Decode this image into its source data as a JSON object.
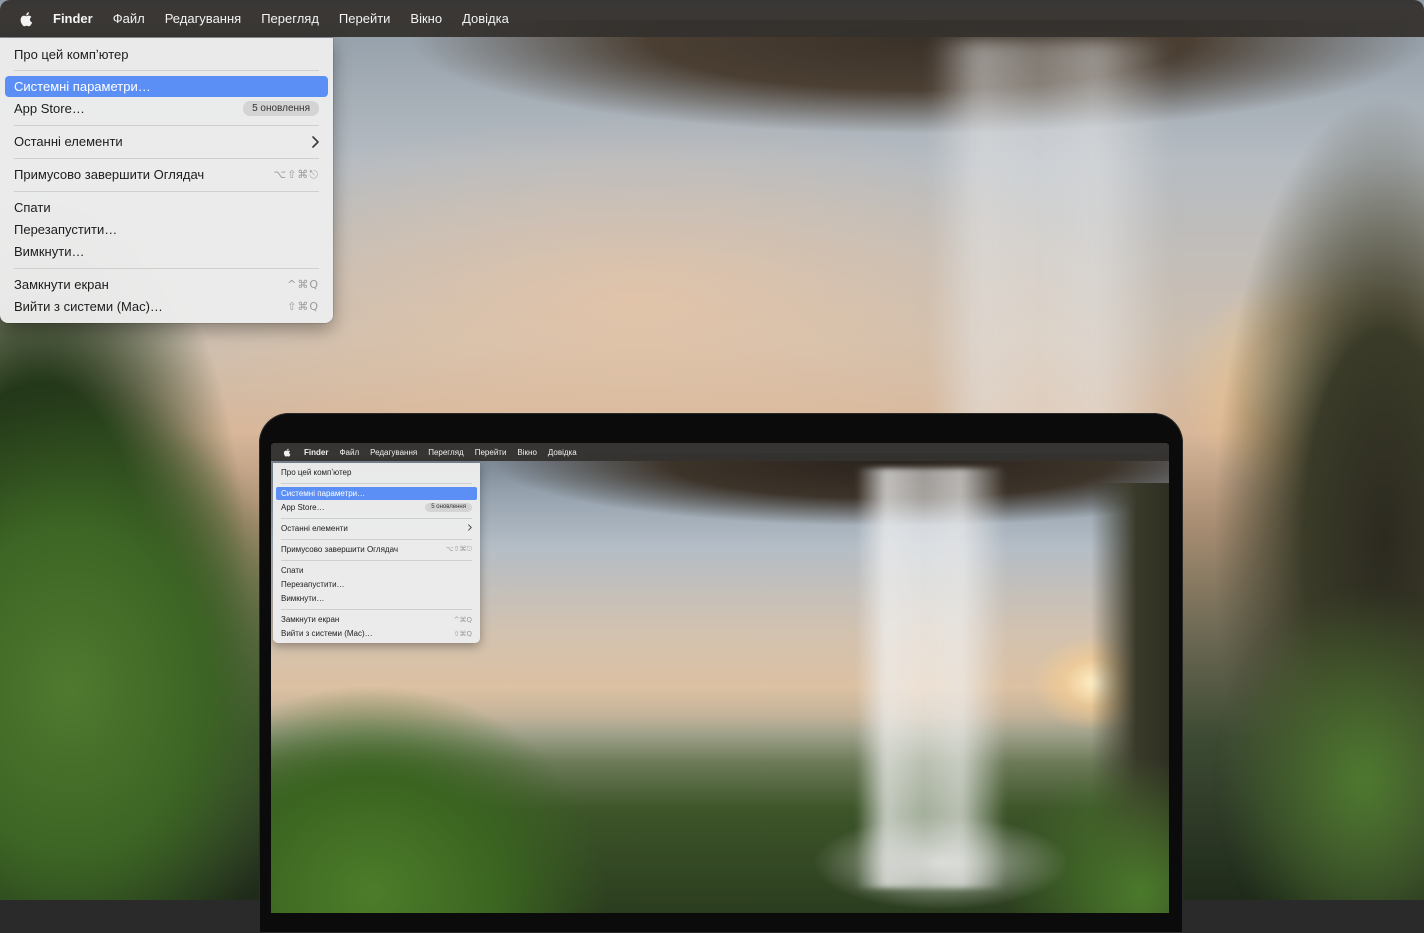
{
  "menubar": {
    "apple_icon": "apple-logo-icon",
    "app_name": "Finder",
    "items": [
      "Файл",
      "Редагування",
      "Перегляд",
      "Перейти",
      "Вікно",
      "Довідка"
    ]
  },
  "apple_menu": {
    "about": "Про цей компʼютер",
    "system_settings": "Системні параметри…",
    "app_store": "App Store…",
    "app_store_badge": "5 оновлення",
    "recent_items": "Останні елементи",
    "force_quit": "Примусово завершити Оглядач",
    "force_quit_shortcut": "⌥⇧⌘⎋",
    "sleep": "Спати",
    "restart": "Перезапустити…",
    "shut_down": "Вимкнути…",
    "lock_screen": "Замкнути екран",
    "lock_screen_shortcut": "^⌘Q",
    "log_out": "Вийти з системи (Mac)…",
    "log_out_shortcut": "⇧⌘Q"
  },
  "colors": {
    "selection": "#5b8ff6",
    "menubar_bg": "#34312e",
    "menu_bg": "#ececec"
  }
}
